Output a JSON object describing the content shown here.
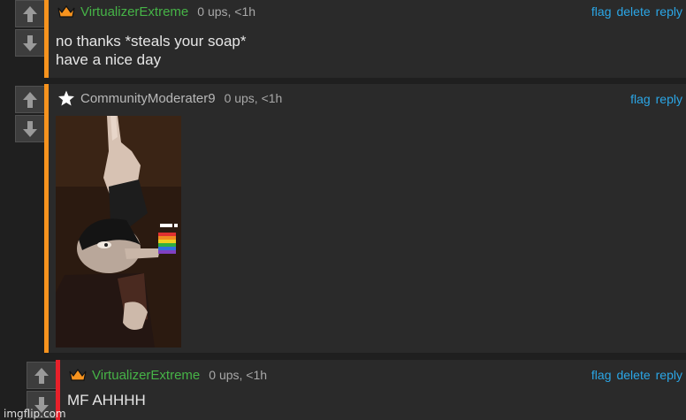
{
  "comments": [
    {
      "username": "VirtualizerExtreme",
      "meta": "0 ups, <1h",
      "actions": [
        "flag",
        "delete",
        "reply"
      ],
      "text": "no thanks *steals your soap*\nhave a nice day",
      "user_icon": "crown-icon"
    },
    {
      "username": "CommunityModerater9",
      "meta": "0 ups, <1h",
      "actions": [
        "flag",
        "reply"
      ],
      "user_icon": "star-icon",
      "image": "meme-image"
    },
    {
      "username": "VirtualizerExtreme",
      "meta": "0 ups, <1h",
      "actions": [
        "flag",
        "delete",
        "reply"
      ],
      "text": "MF AHHHH",
      "user_icon": "crown-icon"
    }
  ],
  "watermark": "imgflip.com",
  "colors": {
    "accent_orange": "#f7931e",
    "accent_red": "#e8202a",
    "username_green": "#46b347",
    "link_blue": "#2ba6e6"
  }
}
